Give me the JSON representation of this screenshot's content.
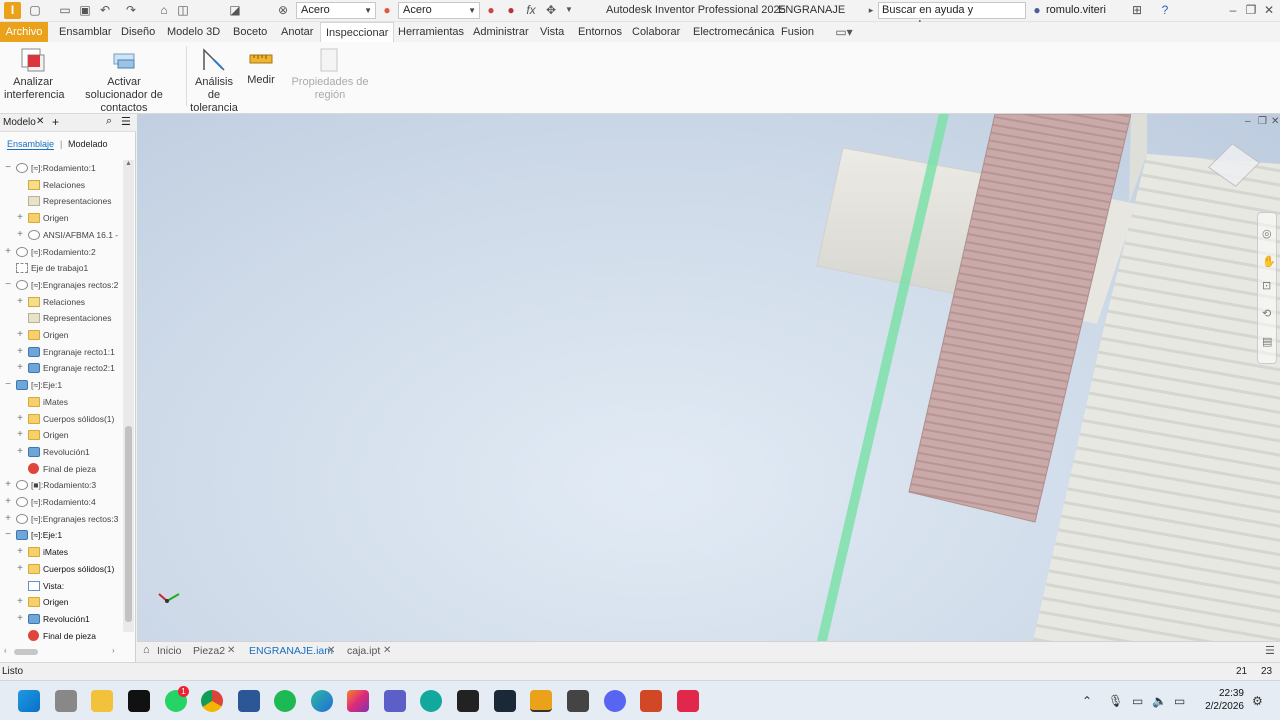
{
  "titlebar": {
    "material1": "Acero",
    "material2": "Acero",
    "app_title": "Autodesk Inventor Professional 2025",
    "document": "ENGRANAJE",
    "help_search": "Buscar en ayuda y comandos...",
    "user": "romulo.viteri"
  },
  "menu": {
    "file": "Archivo",
    "tabs": [
      "Ensamblar",
      "Diseño",
      "Modelo 3D",
      "Boceto",
      "Anotar",
      "Inspeccionar",
      "Herramientas",
      "Administrar",
      "Vista",
      "Entornos",
      "Colaborar",
      "Electromecánica",
      "Fusion"
    ],
    "active": "Inspeccionar"
  },
  "ribbon": {
    "analyze_line1": "Analizar",
    "analyze_line2": "interferencia",
    "activate_line1": "Activar",
    "activate_line2": "solucionador de contactos",
    "tolerance_line1": "Análisis de",
    "tolerance_line2": "tolerancia",
    "measure": "Medir",
    "region_props": "Propiedades de región"
  },
  "browser": {
    "tab": "Modelo",
    "sub_assembly": "Ensamblaje",
    "sub_modeling": "Modelado",
    "tree": [
      {
        "pm": "−",
        "indent": 0,
        "icon": "asm",
        "label": "[≈]:Rodamiento:1",
        "bold": false
      },
      {
        "pm": "",
        "indent": 1,
        "icon": "rel",
        "label": "Relaciones",
        "bold": false
      },
      {
        "pm": "",
        "indent": 1,
        "icon": "rep",
        "label": "Representaciones",
        "bold": false
      },
      {
        "pm": "+",
        "indent": 1,
        "icon": "folder",
        "label": "Origen",
        "bold": false
      },
      {
        "pm": "+",
        "indent": 1,
        "icon": "asm",
        "label": "ANSI/AFBMA 16.1 -",
        "bold": false
      },
      {
        "pm": "+",
        "indent": 0,
        "icon": "asm",
        "label": "[≈]:Rodamiento:2",
        "bold": false
      },
      {
        "pm": "",
        "indent": 0,
        "icon": "work",
        "label": "Eje de trabajo1",
        "bold": false
      },
      {
        "pm": "−",
        "indent": 0,
        "icon": "asm",
        "label": "[≈]:Engranajes rectos:2",
        "bold": false
      },
      {
        "pm": "+",
        "indent": 1,
        "icon": "rel",
        "label": "Relaciones",
        "bold": false
      },
      {
        "pm": "",
        "indent": 1,
        "icon": "rep",
        "label": "Representaciones",
        "bold": false
      },
      {
        "pm": "+",
        "indent": 1,
        "icon": "folder",
        "label": "Origen",
        "bold": false
      },
      {
        "pm": "+",
        "indent": 1,
        "icon": "part",
        "label": "Engranaje recto1:1",
        "bold": false
      },
      {
        "pm": "+",
        "indent": 1,
        "icon": "part",
        "label": "Engranaje recto2:1",
        "bold": false
      },
      {
        "pm": "−",
        "indent": 0,
        "icon": "part",
        "label": "[≈]:Eje:1",
        "bold": false
      },
      {
        "pm": "",
        "indent": 1,
        "icon": "folder",
        "label": "iMates",
        "bold": false
      },
      {
        "pm": "+",
        "indent": 1,
        "icon": "folder",
        "label": "Cuerpos sólidos(1)",
        "bold": false
      },
      {
        "pm": "+",
        "indent": 1,
        "icon": "folder",
        "label": "Origen",
        "bold": false
      },
      {
        "pm": "+",
        "indent": 1,
        "icon": "part",
        "label": "Revolución1",
        "bold": false
      },
      {
        "pm": "",
        "indent": 1,
        "icon": "err",
        "label": "Final de pieza",
        "bold": false
      },
      {
        "pm": "+",
        "indent": 0,
        "icon": "asm",
        "label": "[■]:Rodamiento:3",
        "bold": false
      },
      {
        "pm": "+",
        "indent": 0,
        "icon": "asm",
        "label": "[≈]:Rodamiento:4",
        "bold": false
      },
      {
        "pm": "+",
        "indent": 0,
        "icon": "asm",
        "label": "[≈]:Engranajes rectos:3",
        "bold": false
      },
      {
        "pm": "−",
        "indent": 0,
        "icon": "part",
        "label": "[≈]:Eje:1",
        "bold": true
      },
      {
        "pm": "+",
        "indent": 1,
        "icon": "folder",
        "label": "iMates",
        "bold": true
      },
      {
        "pm": "+",
        "indent": 1,
        "icon": "folder",
        "label": "Cuerpos sólidos(1)",
        "bold": true
      },
      {
        "pm": "",
        "indent": 1,
        "icon": "view",
        "label": "Vista:",
        "bold": true
      },
      {
        "pm": "+",
        "indent": 1,
        "icon": "folder",
        "label": "Origen",
        "bold": true
      },
      {
        "pm": "+",
        "indent": 1,
        "icon": "part",
        "label": "Revolución1",
        "bold": true
      },
      {
        "pm": "",
        "indent": 1,
        "icon": "err",
        "label": "Final de pieza",
        "bold": true
      }
    ]
  },
  "doc_tabs": [
    {
      "label": "Inicio",
      "active": false,
      "closable": false
    },
    {
      "label": "Pieza2",
      "active": false,
      "closable": true
    },
    {
      "label": "ENGRANAJE.iam",
      "active": true,
      "closable": true
    },
    {
      "label": "caja.ipt",
      "active": false,
      "closable": true
    }
  ],
  "status": {
    "text": "Listo",
    "num1": "21",
    "num2": "23"
  },
  "taskbar": {
    "time": "22:39",
    "date": "2/2/2026",
    "whatsapp_badge": "1"
  },
  "colors": {
    "file_tab": "#e9a21a",
    "accent": "#1a6fc2",
    "viewport_bg": "#d3deea",
    "gear": "#c8a9a8",
    "axis": "#7ce0a8"
  }
}
